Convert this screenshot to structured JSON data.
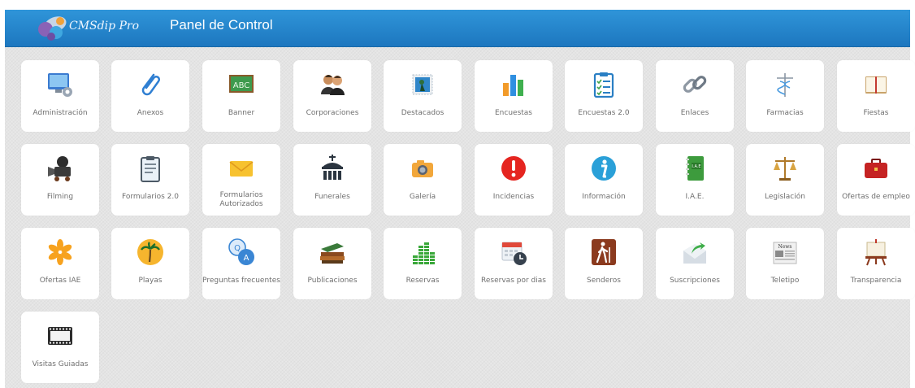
{
  "header": {
    "brand": "CMSdip Pro",
    "title": "Panel de Control"
  },
  "tiles": [
    {
      "label": "Administración",
      "icon": "admin-monitor-gear-icon"
    },
    {
      "label": "Anexos",
      "icon": "paperclip-icon"
    },
    {
      "label": "Banner",
      "icon": "abc-chalkboard-icon"
    },
    {
      "label": "Corporaciones",
      "icon": "people-icon"
    },
    {
      "label": "Destacados",
      "icon": "stamp-picture-icon"
    },
    {
      "label": "Encuestas",
      "icon": "bar-chart-icon"
    },
    {
      "label": "Encuestas 2.0",
      "icon": "checklist-clipboard-icon"
    },
    {
      "label": "Enlaces",
      "icon": "chain-link-icon"
    },
    {
      "label": "Farmacias",
      "icon": "caduceus-icon"
    },
    {
      "label": "Fiestas",
      "icon": "open-book-icon"
    },
    {
      "label": "Filming",
      "icon": "movie-camera-icon"
    },
    {
      "label": "Formularios 2.0",
      "icon": "form-clipboard-icon"
    },
    {
      "label": "Formularios Autorizados",
      "icon": "envelope-icon"
    },
    {
      "label": "Funerales",
      "icon": "church-icon"
    },
    {
      "label": "Galería",
      "icon": "camera-icon"
    },
    {
      "label": "Incidencias",
      "icon": "alert-icon"
    },
    {
      "label": "Información",
      "icon": "info-icon"
    },
    {
      "label": "I.A.E.",
      "icon": "green-notebook-icon"
    },
    {
      "label": "Legislación",
      "icon": "scales-icon"
    },
    {
      "label": "Ofertas de empleo",
      "icon": "briefcase-icon"
    },
    {
      "label": "Ofertas IAE",
      "icon": "orange-asterisk-icon"
    },
    {
      "label": "Playas",
      "icon": "palm-tree-icon"
    },
    {
      "label": "Preguntas frecuentes",
      "icon": "qa-bubbles-icon"
    },
    {
      "label": "Publicaciones",
      "icon": "books-icon"
    },
    {
      "label": "Reservas",
      "icon": "green-bars-icon"
    },
    {
      "label": "Reservas por dias",
      "icon": "calendar-clock-icon"
    },
    {
      "label": "Senderos",
      "icon": "hiker-icon"
    },
    {
      "label": "Suscripciones",
      "icon": "mail-arrow-icon"
    },
    {
      "label": "Teletipo",
      "icon": "newspaper-icon"
    },
    {
      "label": "Transparencia",
      "icon": "easel-icon"
    },
    {
      "label": "Visitas Guiadas",
      "icon": "film-strip-icon"
    }
  ],
  "colors": {
    "header_top": "#2f95d9",
    "header_bottom": "#1d77bf",
    "background": "#e4e4e4",
    "tile": "#ffffff",
    "label": "#6f6f6f"
  }
}
